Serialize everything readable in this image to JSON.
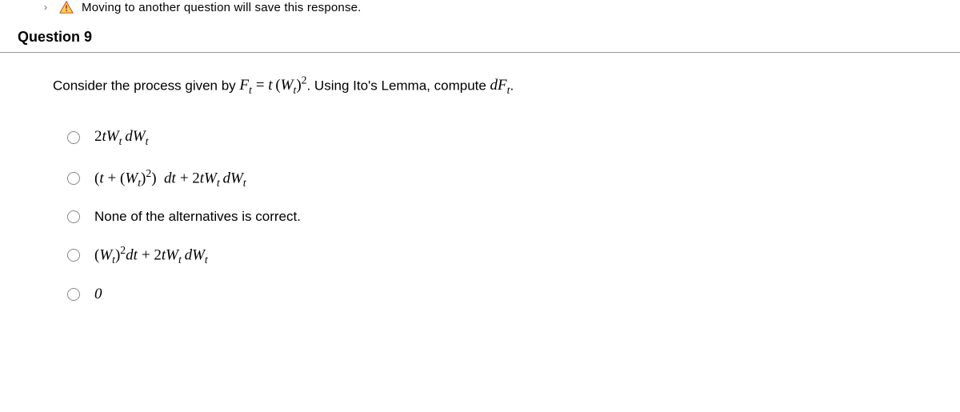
{
  "topbar": {
    "text": "Moving to another question will save this response."
  },
  "question": {
    "number_label": "Question 9",
    "prompt_prefix": "Consider the process given by ",
    "prompt_middle": ".  Using Ito's Lemma, compute ",
    "prompt_suffix": "."
  },
  "options": {
    "opt3_text": "None of the alternatives is correct.",
    "opt5_text": "0"
  }
}
